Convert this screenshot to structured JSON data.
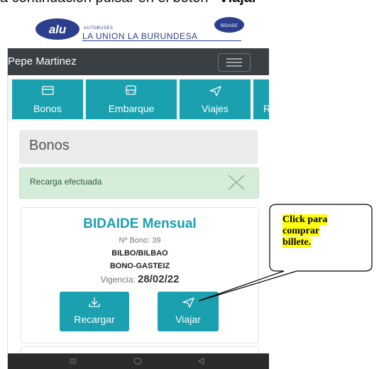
{
  "instruction": {
    "prefix": "a continuación pulsar en el botón ",
    "bold": "\"Viajar\""
  },
  "logo": {
    "oval_text": "alu",
    "small": "AUTOBUSES",
    "name": "LA UNION LA BURUNDESA",
    "badge": "BIDAIDE"
  },
  "topbar": {
    "user": "Pepe Martinez"
  },
  "tabs": [
    {
      "label": "Bonos",
      "icon": "card-icon"
    },
    {
      "label": "Embarque",
      "icon": "bus-icon"
    },
    {
      "label": "Viajes",
      "icon": "send-icon"
    },
    {
      "label": "R",
      "icon": ""
    }
  ],
  "section": {
    "title": "Bonos"
  },
  "alert": {
    "text": "Recarga efectuada"
  },
  "card": {
    "title": "BIDAIDE Mensual",
    "bono": "Nº Bono: 39",
    "route": "BILBO/BILBAO",
    "type": "BONO-GASTEIZ",
    "vigencia_label": "Vigencia: ",
    "vigencia_value": "28/02/22",
    "recargar_label": "Recargar",
    "viajar_label": "Viajar"
  },
  "callout": {
    "line1": "Click para",
    "line2": "comprar",
    "line3": "billete."
  },
  "colors": {
    "teal": "#1aa0ae",
    "dark": "#3a3f44",
    "success_bg": "#d5ecd9",
    "highlight": "#ffff00"
  }
}
